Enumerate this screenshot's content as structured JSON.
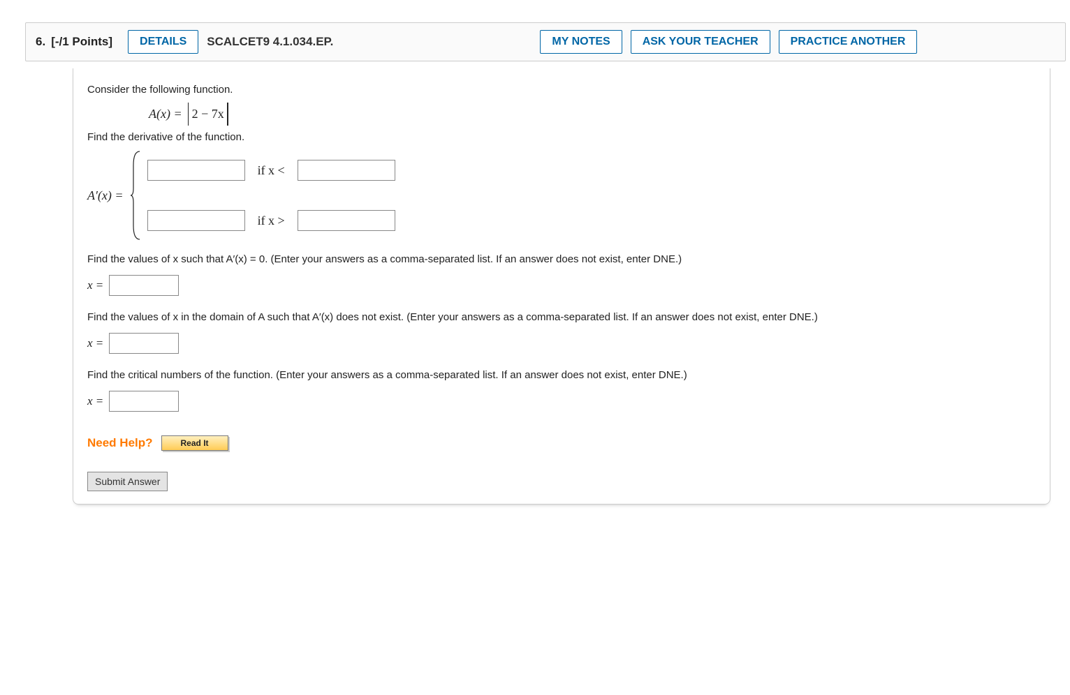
{
  "header": {
    "question_number": "6.",
    "points": "[-/1 Points]",
    "details_label": "DETAILS",
    "source_label": "SCALCET9 4.1.034.EP.",
    "my_notes": "MY NOTES",
    "ask_teacher": "ASK YOUR TEACHER",
    "practice_another": "PRACTICE ANOTHER"
  },
  "body": {
    "intro": "Consider the following function.",
    "fn_lhs": "A(x) =",
    "fn_abs_inner": "2 − 7x",
    "deriv_prompt": "Find the derivative of the function.",
    "aprime_label": "A′(x) =",
    "ifx_lt": "if x <",
    "ifx_gt": "if x >",
    "q2": "Find the values of x such that A′(x) = 0. (Enter your answers as a comma-separated list. If an answer does not exist, enter DNE.)",
    "xeq": "x =",
    "q3": "Find the values of x in the domain of A such that A′(x) does not exist. (Enter your answers as a comma-separated list. If an answer does not exist, enter DNE.)",
    "q4": "Find the critical numbers of the function. (Enter your answers as a comma-separated list. If an answer does not exist, enter DNE.)",
    "need_help": "Need Help?",
    "read_it": "Read It",
    "submit": "Submit Answer"
  }
}
